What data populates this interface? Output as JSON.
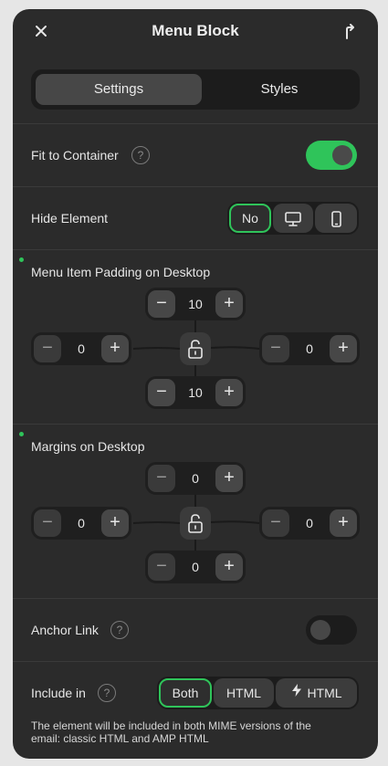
{
  "header": {
    "close_icon": "close-icon",
    "title": "Menu Block",
    "export_icon": "share-arrow-icon"
  },
  "tabs": [
    {
      "label": "Settings",
      "active": true
    },
    {
      "label": "Styles",
      "active": false
    }
  ],
  "fit_to_container": {
    "label": "Fit to Container",
    "help": "?",
    "enabled": true
  },
  "hide_element": {
    "label": "Hide Element",
    "options": [
      {
        "label": "No",
        "selected": true
      },
      {
        "icon": "desktop-icon"
      },
      {
        "icon": "mobile-icon"
      }
    ]
  },
  "padding": {
    "label": "Menu Item Padding on Desktop",
    "top": "10",
    "left": "0",
    "right": "0",
    "bottom": "10"
  },
  "margins": {
    "label": "Margins on Desktop",
    "top": "0",
    "left": "0",
    "right": "0",
    "bottom": "0"
  },
  "anchor_link": {
    "label": "Anchor Link",
    "help": "?",
    "enabled": false
  },
  "include_in": {
    "label": "Include in",
    "help": "?",
    "options": [
      {
        "label": "Both",
        "selected": true
      },
      {
        "label": "HTML"
      },
      {
        "label": "HTML",
        "icon": "lightning-icon"
      }
    ],
    "note": "The element will be included in both MIME versions of the email: classic HTML and AMP HTML"
  },
  "colors": {
    "accent": "#2fc45a",
    "panel": "#2b2b2b",
    "control": "#1c1c1c"
  }
}
